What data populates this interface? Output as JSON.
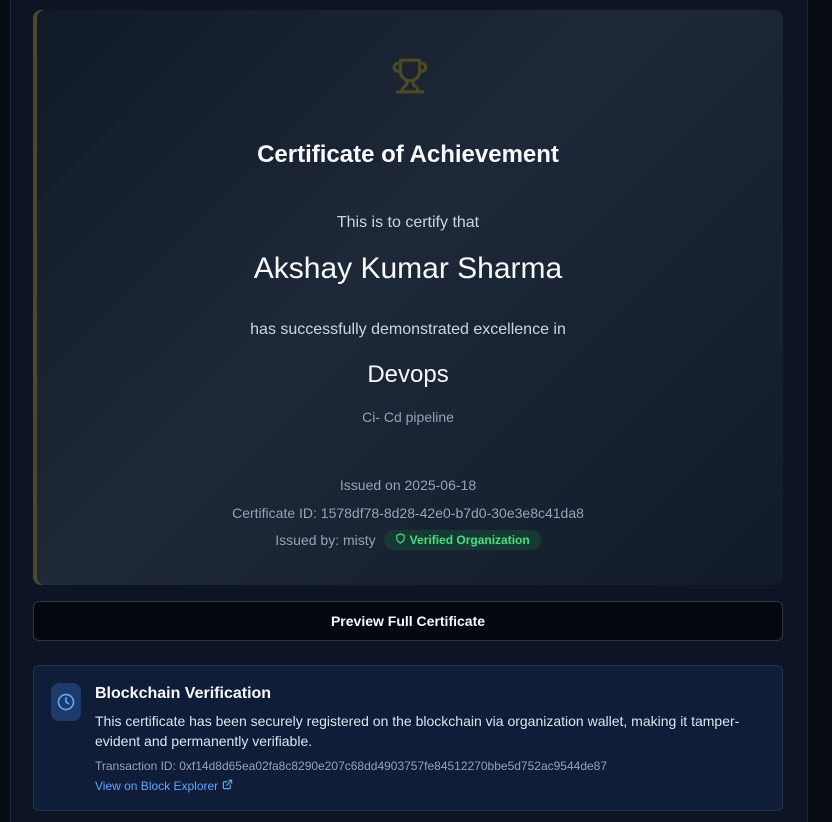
{
  "certificate": {
    "icon": "trophy-icon",
    "title": "Certificate of Achievement",
    "certify_text": "This is to certify that",
    "recipient_name": "Akshay Kumar Sharma",
    "excellence_text": "has successfully demonstrated excellence in",
    "skill": "Devops",
    "skill_description": "Ci- Cd pipeline",
    "issued_on": "Issued on 2025-06-18",
    "certificate_id": "Certificate ID: 1578df78-8d28-42e0-b7d0-30e3e8c41da8",
    "issued_by": "Issued by: misty",
    "verified_badge": "Verified Organization",
    "accent_color": "#4a4a24"
  },
  "actions": {
    "preview_label": "Preview Full Certificate"
  },
  "blockchain": {
    "icon": "clock-icon",
    "title": "Blockchain Verification",
    "description": "This certificate has been securely registered on the blockchain via organization wallet, making it tamper-evident and permanently verifiable.",
    "transaction_id": "Transaction ID: 0xf14d8d65ea02fa8c8290e207c68dd4903757fe84512270bbe5d752ac9544de87",
    "explorer_link": "View on Block Explorer",
    "link_color": "#60a5fa",
    "verified_color": "#4ade80"
  }
}
